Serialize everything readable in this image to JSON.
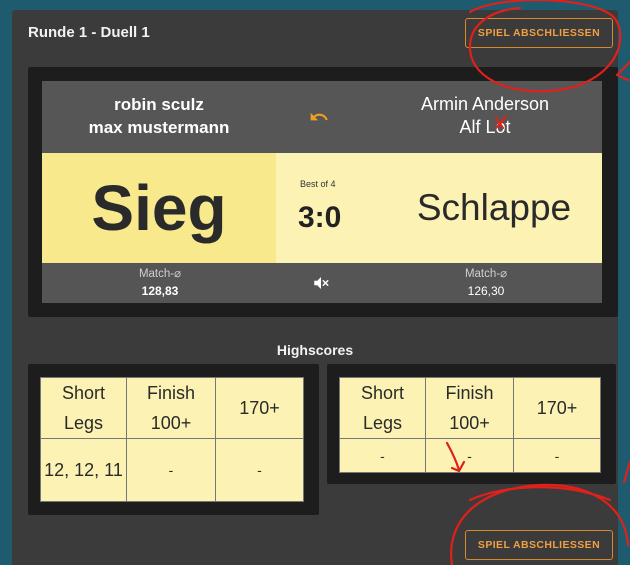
{
  "header": {
    "round_title": "Runde 1 - Duell 1",
    "finish_button_label": "SPIEL ABSCHLIESSEN"
  },
  "match": {
    "left_team": {
      "player1": "robin sculz",
      "player2": "max mustermann"
    },
    "right_team": {
      "player1": "Armin Anderson",
      "player2": "Alf Lot"
    },
    "left_result": "Sieg",
    "right_result": "Schlappe",
    "best_of": "Best of 4",
    "score": "3:0",
    "average_label": "Match-⌀",
    "left_average": "128,83",
    "right_average": "126,30"
  },
  "highscores": {
    "title": "Highscores",
    "columns": [
      "Short Legs",
      "Finish 100+",
      "170+"
    ],
    "left_values": [
      "12, 12, 11",
      "-",
      "-"
    ],
    "right_values": [
      "-",
      "-",
      "-"
    ]
  },
  "colors": {
    "accent": "#f0a040",
    "win_cell": "#f7e98c",
    "table_bg": "#fbf2b4",
    "panel": "#3b3b3b",
    "annotation": "#e0201a"
  },
  "icons": {
    "undo": "undo-icon",
    "mute": "volume-off-icon"
  }
}
